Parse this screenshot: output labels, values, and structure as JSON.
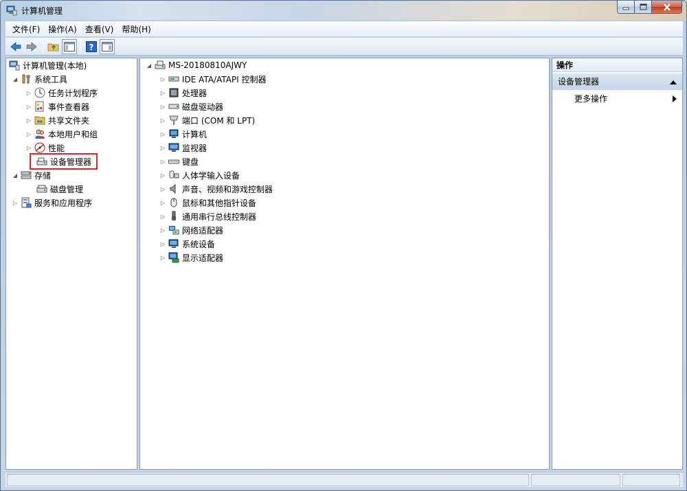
{
  "window": {
    "title": "计算机管理"
  },
  "menu": [
    "文件(F)",
    "操作(A)",
    "查看(V)",
    "帮助(H)"
  ],
  "left_tree": {
    "root": "计算机管理(本地)",
    "system_tools": "系统工具",
    "task_scheduler": "任务计划程序",
    "event_viewer": "事件查看器",
    "shared_folders": "共享文件夹",
    "local_users": "本地用户和组",
    "performance": "性能",
    "device_manager": "设备管理器",
    "storage": "存储",
    "disk_management": "磁盘管理",
    "services_apps": "服务和应用程序"
  },
  "device_tree": {
    "computer_name": "MS-20180810AJWY",
    "categories": [
      "IDE ATA/ATAPI 控制器",
      "处理器",
      "磁盘驱动器",
      "端口 (COM 和 LPT)",
      "计算机",
      "监视器",
      "键盘",
      "人体学输入设备",
      "声音、视频和游戏控制器",
      "鼠标和其他指针设备",
      "通用串行总线控制器",
      "网络适配器",
      "系统设备",
      "显示适配器"
    ]
  },
  "actions": {
    "header": "操作",
    "section": "设备管理器",
    "more": "更多操作"
  },
  "colors": {
    "highlight_border": "#e0262b",
    "action_section_bg": "#c4d5e8"
  }
}
